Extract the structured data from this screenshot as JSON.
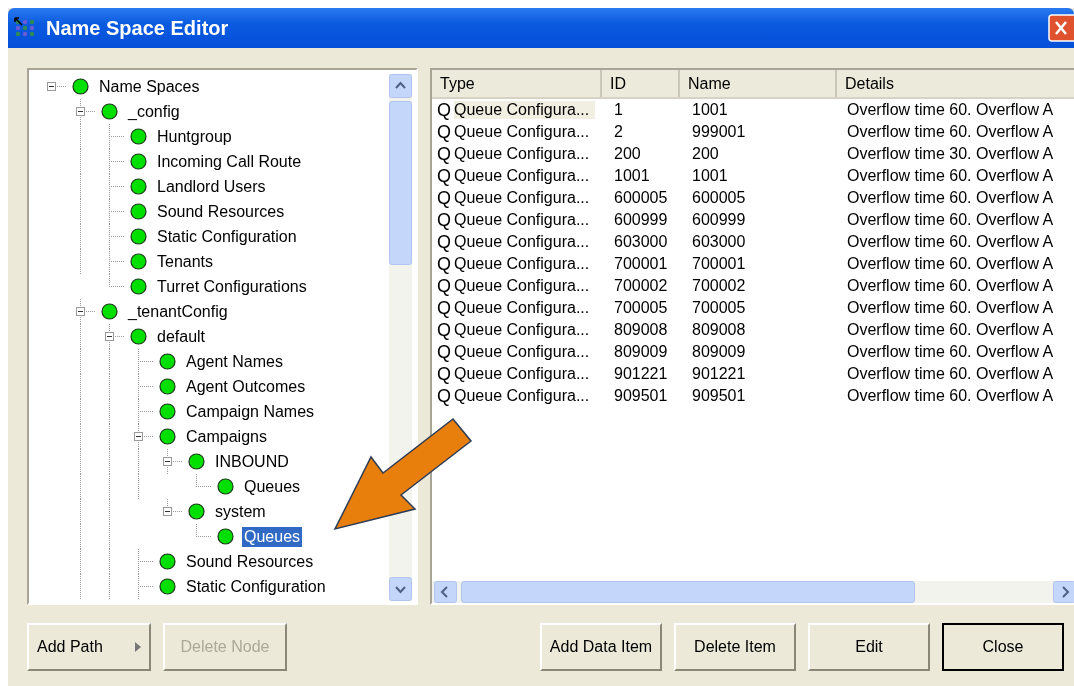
{
  "window": {
    "title": "Name Space Editor"
  },
  "tree": {
    "label": "Name Spaces",
    "expanded": true,
    "selected": false,
    "children": [
      {
        "label": "_config",
        "expanded": true,
        "selected": false,
        "children": [
          {
            "label": "Huntgroup",
            "selected": false
          },
          {
            "label": "Incoming Call Route",
            "selected": false
          },
          {
            "label": "Landlord Users",
            "selected": false
          },
          {
            "label": "Sound Resources",
            "selected": false
          },
          {
            "label": "Static Configuration",
            "selected": false
          },
          {
            "label": "Tenants",
            "selected": false
          },
          {
            "label": "Turret Configurations",
            "selected": false
          }
        ]
      },
      {
        "label": "_tenantConfig",
        "expanded": true,
        "selected": false,
        "children": [
          {
            "label": "default",
            "expanded": true,
            "selected": false,
            "children": [
              {
                "label": "Agent Names",
                "selected": false
              },
              {
                "label": "Agent Outcomes",
                "selected": false
              },
              {
                "label": "Campaign Names",
                "selected": false
              },
              {
                "label": "Campaigns",
                "expanded": true,
                "selected": false,
                "children": [
                  {
                    "label": "INBOUND",
                    "expanded": true,
                    "selected": false,
                    "children": [
                      {
                        "label": "Queues",
                        "selected": false
                      }
                    ]
                  },
                  {
                    "label": "system",
                    "expanded": true,
                    "selected": false,
                    "children": [
                      {
                        "label": "Queues",
                        "selected": true
                      }
                    ]
                  }
                ]
              },
              {
                "label": "Sound Resources",
                "selected": false
              },
              {
                "label": "Static Configuration",
                "selected": false
              }
            ]
          }
        ]
      }
    ]
  },
  "table": {
    "columns": [
      "Type",
      "ID",
      "Name",
      "Details"
    ],
    "rows": [
      {
        "icon": "Q",
        "type": "Queue Configura...",
        "id": "1",
        "name": "1001",
        "details": "Overflow time 60. Overflow A",
        "selected": true
      },
      {
        "icon": "Q",
        "type": "Queue Configura...",
        "id": "2",
        "name": "999001",
        "details": "Overflow time 60. Overflow A",
        "selected": false
      },
      {
        "icon": "Q",
        "type": "Queue Configura...",
        "id": "200",
        "name": "200",
        "details": "Overflow time 30. Overflow A",
        "selected": false
      },
      {
        "icon": "Q",
        "type": "Queue Configura...",
        "id": "1001",
        "name": "1001",
        "details": "Overflow time 60. Overflow A",
        "selected": false
      },
      {
        "icon": "Q",
        "type": "Queue Configura...",
        "id": "600005",
        "name": "600005",
        "details": "Overflow time 60. Overflow A",
        "selected": false
      },
      {
        "icon": "Q",
        "type": "Queue Configura...",
        "id": "600999",
        "name": "600999",
        "details": "Overflow time 60. Overflow A",
        "selected": false
      },
      {
        "icon": "Q",
        "type": "Queue Configura...",
        "id": "603000",
        "name": "603000",
        "details": "Overflow time 60. Overflow A",
        "selected": false
      },
      {
        "icon": "Q",
        "type": "Queue Configura...",
        "id": "700001",
        "name": "700001",
        "details": "Overflow time 60. Overflow A",
        "selected": false
      },
      {
        "icon": "Q",
        "type": "Queue Configura...",
        "id": "700002",
        "name": "700002",
        "details": "Overflow time 60. Overflow A",
        "selected": false
      },
      {
        "icon": "Q",
        "type": "Queue Configura...",
        "id": "700005",
        "name": "700005",
        "details": "Overflow time 60. Overflow A",
        "selected": false
      },
      {
        "icon": "Q",
        "type": "Queue Configura...",
        "id": "809008",
        "name": "809008",
        "details": "Overflow time 60. Overflow A",
        "selected": false
      },
      {
        "icon": "Q",
        "type": "Queue Configura...",
        "id": "809009",
        "name": "809009",
        "details": "Overflow time 60. Overflow A",
        "selected": false
      },
      {
        "icon": "Q",
        "type": "Queue Configura...",
        "id": "901221",
        "name": "901221",
        "details": "Overflow time 60. Overflow A",
        "selected": false
      },
      {
        "icon": "Q",
        "type": "Queue Configura...",
        "id": "909501",
        "name": "909501",
        "details": "Overflow time 60. Overflow A",
        "selected": false
      }
    ]
  },
  "left_buttons": [
    {
      "label": "Add Path",
      "kind": "menu",
      "disabled": false
    },
    {
      "label": "Delete Node",
      "kind": "plain",
      "disabled": true
    }
  ],
  "right_buttons": [
    {
      "label": "Add Data Item",
      "default": false
    },
    {
      "label": "Delete Item",
      "default": false
    },
    {
      "label": "Edit",
      "default": false
    },
    {
      "label": "Close",
      "default": true
    }
  ]
}
